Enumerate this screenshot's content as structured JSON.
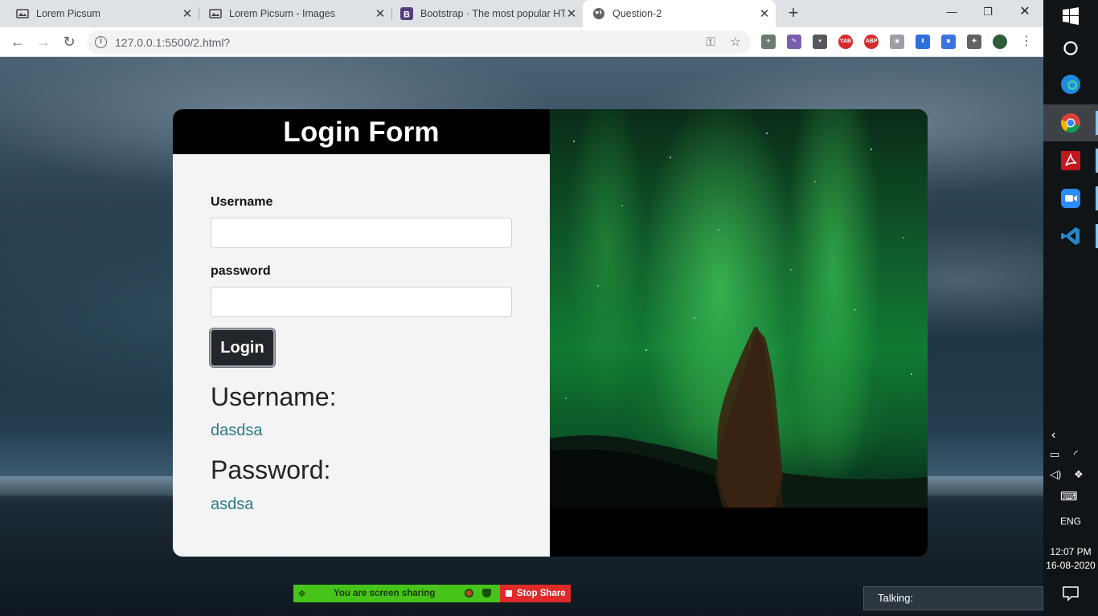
{
  "browser": {
    "tabs": [
      {
        "title": "Lorem Picsum",
        "active": false
      },
      {
        "title": "Lorem Picsum - Images",
        "active": false
      },
      {
        "title": "Bootstrap · The most popular HTML",
        "active": false
      },
      {
        "title": "Question-2",
        "active": true
      }
    ],
    "url": "127.0.0.1:5500/2.html?",
    "window_controls": [
      "minimize",
      "restore",
      "close"
    ],
    "extensions": [
      "key-icon",
      "star-icon",
      "ext-bird",
      "ext-pen",
      "ext-bucket",
      "ext-yab",
      "ext-abp",
      "ext-camera",
      "ext-download",
      "ext-screenshot",
      "puzzle-icon",
      "profile-avatar",
      "menu-icon"
    ]
  },
  "page": {
    "form_title": "Login Form",
    "username_label": "Username",
    "username_value": "",
    "password_label": "password",
    "password_value": "",
    "login_button": "Login",
    "output_username_heading": "Username:",
    "output_username_value": "dasdsa",
    "output_password_heading": "Password:",
    "output_password_value": "asdsa"
  },
  "screen_share": {
    "status": "You are screen sharing",
    "stop": "Stop Share",
    "talking": "Talking:"
  },
  "taskbar": {
    "apps": [
      "windows-start",
      "cortana",
      "edge",
      "chrome",
      "acrobat",
      "zoom",
      "vscode"
    ],
    "language": "ENG",
    "time": "12:07 PM",
    "date": "16-08-2020"
  },
  "colors": {
    "accent_link": "#2a7a86",
    "share_green": "#47c419",
    "share_red": "#e02a2a",
    "header_black": "#000000"
  }
}
